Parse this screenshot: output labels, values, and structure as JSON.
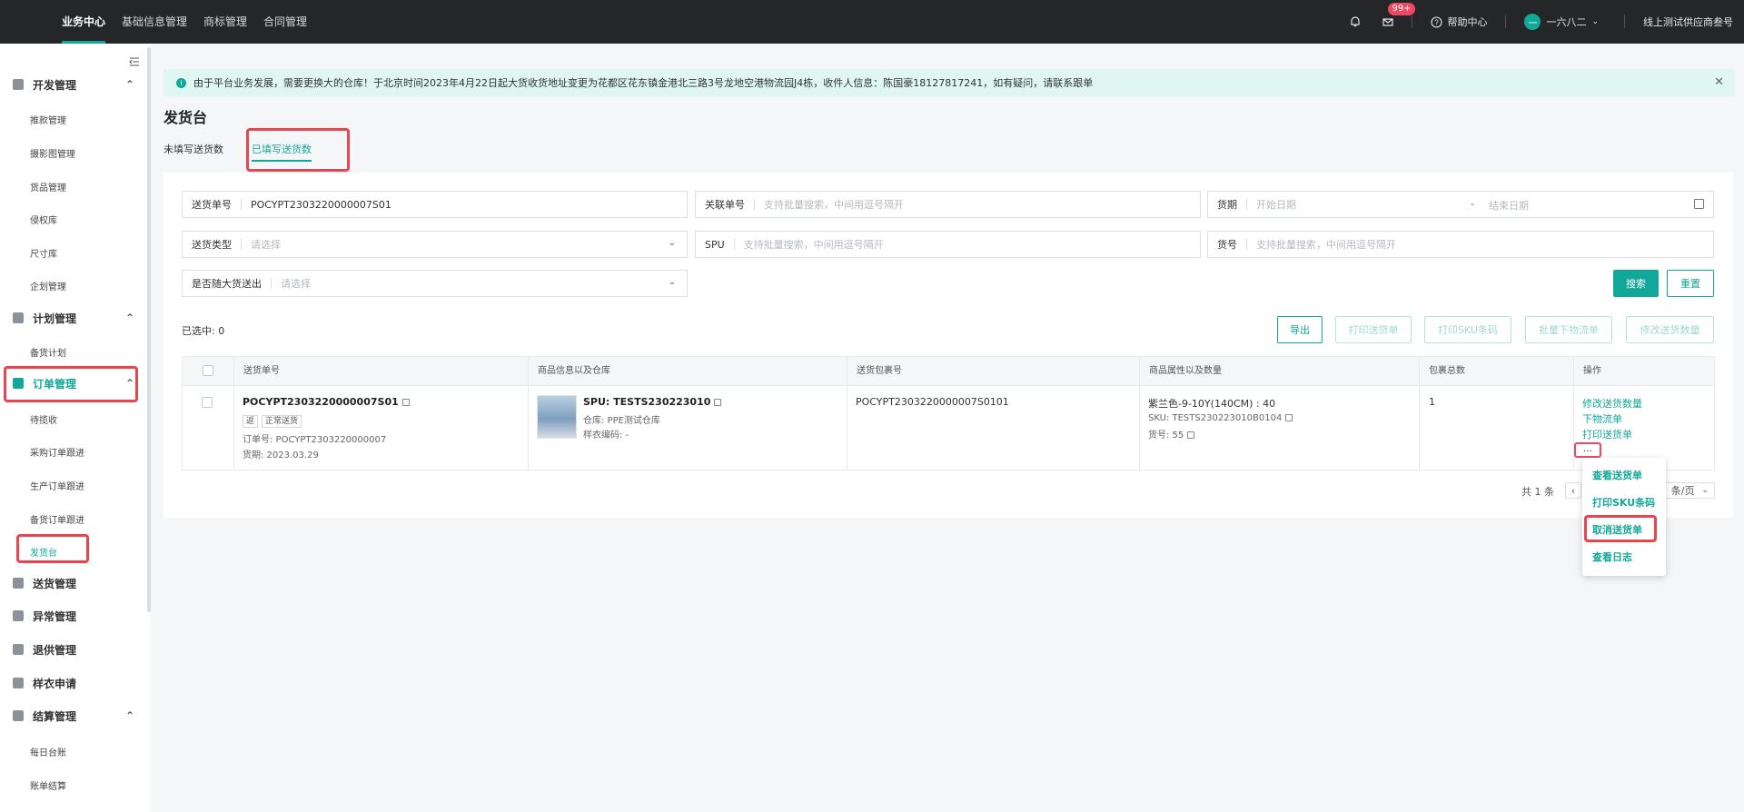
{
  "topbar": {
    "nav": [
      "业务中心",
      "基础信息管理",
      "商标管理",
      "合同管理"
    ],
    "badge": "99+",
    "help": "帮助中心",
    "user": "一六八二",
    "avatar_text": "一",
    "company": "线上测试供应商叁号"
  },
  "sidebar": {
    "groups": [
      {
        "label": "开发管理",
        "items": [
          "推款管理",
          "摄影图管理",
          "货品管理",
          "侵权库",
          "尺寸库",
          "企划管理"
        ]
      },
      {
        "label": "计划管理",
        "items": [
          "备货计划"
        ]
      },
      {
        "label": "订单管理",
        "items": [
          "待揽收",
          "采购订单跟进",
          "生产订单跟进",
          "备货订单跟进",
          "发货台"
        ]
      },
      {
        "label": "送货管理"
      },
      {
        "label": "异常管理"
      },
      {
        "label": "退供管理"
      },
      {
        "label": "样衣申请"
      },
      {
        "label": "结算管理",
        "items": [
          "每日台账",
          "账单结算"
        ]
      }
    ]
  },
  "alert": {
    "text": "由于平台业务发展，需要更换大的仓库！于北京时间2023年4月22日起大货收货地址变更为花都区花东镇金港北三路3号龙地空港物流园J4栋，收件人信息：陈国豪18127817241，如有疑问，请联系跟单"
  },
  "page": {
    "title": "发货台",
    "tabs": [
      "未填写送货数",
      "已填写送货数"
    ]
  },
  "filters": {
    "delivery_no_label": "送货单号",
    "delivery_no_value": "POCYPT2303220000007S01",
    "related_no_label": "关联单号",
    "related_no_placeholder": "支持批量搜索，中间用逗号隔开",
    "due_label": "货期",
    "start_date_placeholder": "开始日期",
    "end_date_placeholder": "结束日期",
    "date_sep": "-",
    "delivery_type_label": "送货类型",
    "select_placeholder": "请选择",
    "spu_label": "SPU",
    "spu_placeholder": "支持批量搜索，中间用逗号隔开",
    "goods_no_label": "货号",
    "goods_no_placeholder": "支持批量搜索，中间用逗号隔开",
    "with_bulk_label": "是否随大货送出",
    "search": "搜索",
    "reset": "重置"
  },
  "toolbar": {
    "selected": "已选中: 0",
    "export": "导出",
    "print_delivery": "打印送货单",
    "print_sku": "打印SKU条码",
    "batch_logistics": "批量下物流单",
    "edit_quantity": "修改送货数量"
  },
  "table": {
    "headers": [
      "送货单号",
      "商品信息以及仓库",
      "送货包裹号",
      "商品属性以及数量",
      "包裹总数",
      "操作"
    ],
    "row": {
      "delivery_no": "POCYPT2303220000007S01",
      "tag1": "返",
      "tag2": "正常送货",
      "order_no": "订单号: POCYPT2303220000007",
      "due_date": "货期: 2023.03.29",
      "spu": "SPU: TESTS230223010",
      "warehouse": "仓库: PPE测试仓库",
      "sample_code": "样衣编码: -",
      "package_no": "POCYPT2303220000007S0101",
      "attr": "紫兰色-9-10Y(140CM) : 40",
      "sku": "SKU: TESTS230223010B0104",
      "goods_no": "货号: 55",
      "package_total": "1",
      "ops": [
        "修改送货数量",
        "下物流单",
        "打印送货单"
      ],
      "more": "..."
    }
  },
  "pagination": {
    "total": "共 1 条",
    "per_page": "10 条/页",
    "per_page_visible": "条/页"
  },
  "dropdown": {
    "items": [
      "查看送货单",
      "打印SKU条码",
      "取消送货单",
      "查看日志"
    ]
  },
  "colors": {
    "accent": "#12a899",
    "highlight": "#e8454f",
    "topbar": "#242628"
  }
}
